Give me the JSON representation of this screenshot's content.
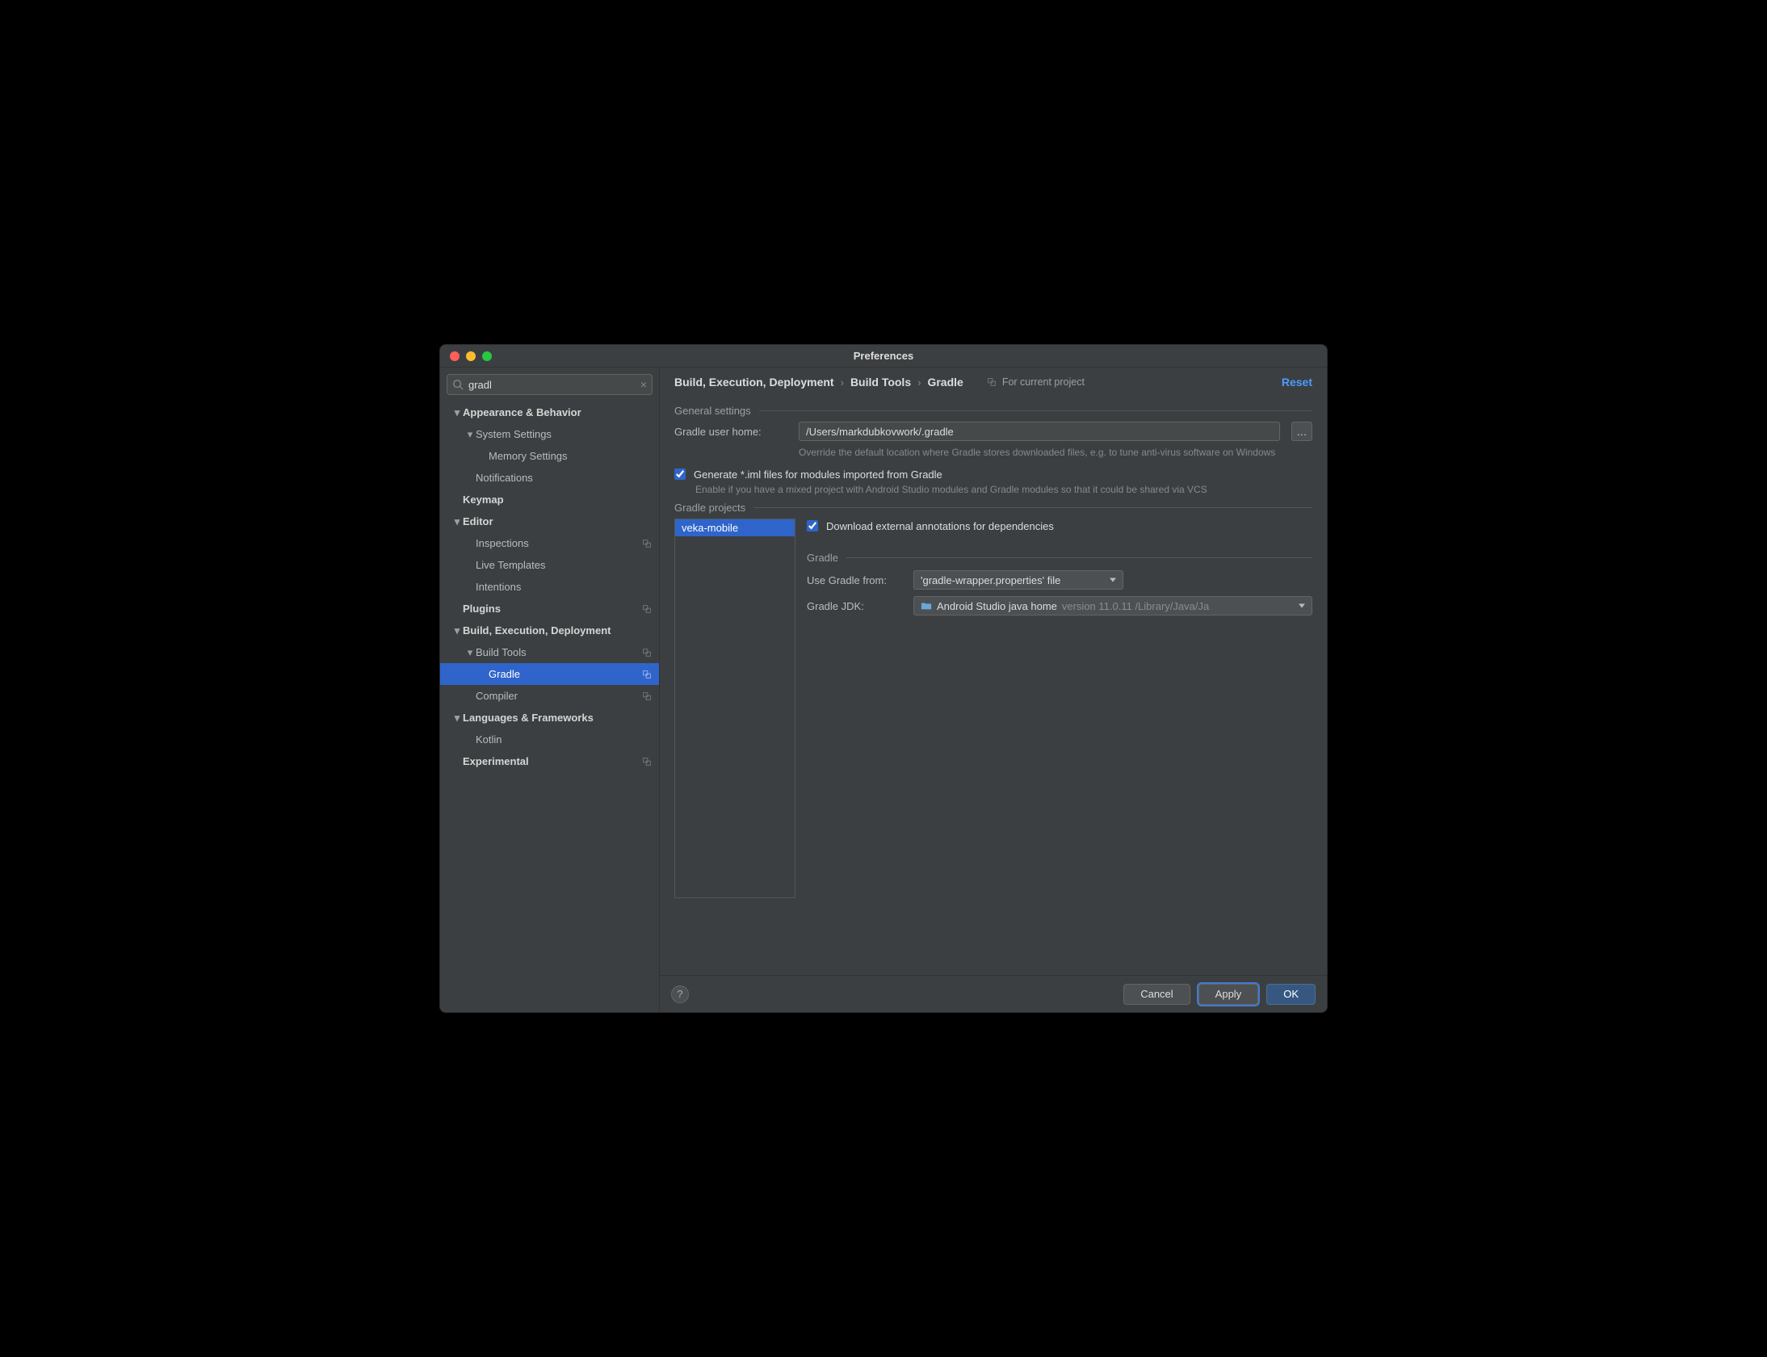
{
  "window_title": "Preferences",
  "search": {
    "value": "gradl"
  },
  "tree": {
    "appearance": "Appearance & Behavior",
    "system_settings": "System Settings",
    "memory_settings": "Memory Settings",
    "notifications": "Notifications",
    "keymap": "Keymap",
    "editor": "Editor",
    "inspections": "Inspections",
    "live_templates": "Live Templates",
    "intentions": "Intentions",
    "plugins": "Plugins",
    "bed": "Build, Execution, Deployment",
    "build_tools": "Build Tools",
    "gradle": "Gradle",
    "compiler": "Compiler",
    "lang_frameworks": "Languages & Frameworks",
    "kotlin": "Kotlin",
    "experimental": "Experimental"
  },
  "breadcrumb": {
    "a": "Build, Execution, Deployment",
    "b": "Build Tools",
    "c": "Gradle",
    "scope": "For current project",
    "reset": "Reset"
  },
  "section_general": "General settings",
  "gradle_user_home_label": "Gradle user home:",
  "gradle_user_home_value": "/Users/markdubkovwork/.gradle",
  "gradle_user_home_hint": "Override the default location where Gradle stores downloaded files, e.g. to tune anti-virus software on Windows",
  "iml_checkbox_label": "Generate *.iml files for modules imported from Gradle",
  "iml_checkbox_hint": "Enable if you have a mixed project with Android Studio modules and Gradle modules so that it could be shared via VCS",
  "section_projects": "Gradle projects",
  "project_list": [
    "veka-mobile"
  ],
  "download_annotations_label": "Download external annotations for dependencies",
  "section_gradle": "Gradle",
  "use_gradle_from_label": "Use Gradle from:",
  "use_gradle_from_value": "'gradle-wrapper.properties' file",
  "gradle_jdk_label": "Gradle JDK:",
  "gradle_jdk_value": "Android Studio java home",
  "gradle_jdk_version": "version 11.0.11 /Library/Java/Ja",
  "buttons": {
    "cancel": "Cancel",
    "apply": "Apply",
    "ok": "OK"
  }
}
